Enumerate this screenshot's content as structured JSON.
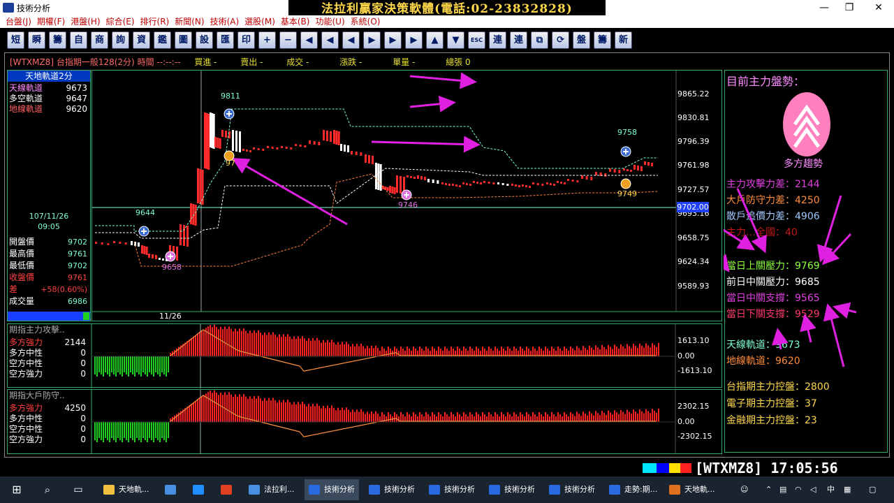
{
  "window": {
    "title": "技術分析",
    "banner": "法拉利贏家決策軟體(電話:02-23832828)"
  },
  "menu": [
    "台盤(J)",
    "期權(F)",
    "港盤(H)",
    "綜合(E)",
    "排行(R)",
    "新聞(N)",
    "技術(A)",
    "選股(M)",
    "基本(B)",
    "功能(U)",
    "系統(O)"
  ],
  "toolbar": [
    "短",
    "瞬",
    "籌",
    "自",
    "商",
    "詢",
    "資",
    "鑑",
    "圖",
    "設",
    "匯",
    "印",
    "+",
    "−",
    "◀",
    "◀",
    "◀",
    "▶",
    "▶",
    "▶",
    "▲",
    "▼",
    "ESC",
    "連",
    "連",
    "⧉",
    "⟳",
    "盤",
    "籌",
    "新"
  ],
  "topinfo": {
    "symbol": "[WTXMZ8]",
    "name": "台指期一般128(2分)",
    "time_label": "時間",
    "time_val": "--:--:--",
    "buy": "買進 -",
    "sell": "賣出 -",
    "deal": "成交 -",
    "change": "漲跌 -",
    "vol": "單量 -",
    "total": "總張 0"
  },
  "left_panel": {
    "header": "天地軌道2分",
    "tracks": [
      {
        "label": "天線軌道",
        "value": "9673",
        "color": "#ff8cff"
      },
      {
        "label": "多空軌道",
        "value": "9647",
        "color": "#ffffff"
      },
      {
        "label": "地線軌道",
        "value": "9620",
        "color": "#ff6060"
      }
    ],
    "date": "107/11/26",
    "time": "09:05",
    "quotes": [
      {
        "label": "開盤價",
        "value": "9702",
        "color": "#ffffff",
        "vcolor": "#7fffd4"
      },
      {
        "label": "最高價",
        "value": "9761",
        "color": "#ffffff",
        "vcolor": "#7fffd4"
      },
      {
        "label": "最低價",
        "value": "9702",
        "color": "#ffffff",
        "vcolor": "#7fffd4"
      },
      {
        "label": "收盤價",
        "value": "9761",
        "color": "#ff4040",
        "vcolor": "#ff4040"
      },
      {
        "label": "差",
        "value": "+58(0.60%)",
        "color": "#ff4040",
        "vcolor": "#ff4040"
      },
      {
        "label": "成交量",
        "value": "6986",
        "color": "#ffffff",
        "vcolor": "#7fffd4"
      }
    ]
  },
  "chart": {
    "y_ticks": [
      "9865.22",
      "9830.81",
      "9796.39",
      "9761.98",
      "9727.57",
      "9693.16",
      "9658.75",
      "9624.34",
      "9589.93"
    ],
    "current_price": "9702.00",
    "x_date": "11/26",
    "markers": [
      {
        "label": "9811",
        "color": "#7fffd4"
      },
      {
        "label": "9644",
        "color": "#7fffd4"
      },
      {
        "label": "9658",
        "color": "#e070e0"
      },
      {
        "label": "9746",
        "color": "#e070e0"
      },
      {
        "label": "9758",
        "color": "#7fffd4"
      },
      {
        "label": "9749",
        "color": "#ffd84a"
      },
      {
        "label": "97",
        "color": "#ffd84a"
      }
    ]
  },
  "sub1": {
    "title": "期指主力攻擊..",
    "rows": [
      {
        "label": "多方強力",
        "value": "2144",
        "color": "#ff4040"
      },
      {
        "label": "多方中性",
        "value": "0",
        "color": "#ffffff"
      },
      {
        "label": "空方中性",
        "value": "0",
        "color": "#ffffff"
      },
      {
        "label": "空方強力",
        "value": "0",
        "color": "#ffffff"
      }
    ],
    "y_ticks": [
      "1613.10",
      "0.00",
      "-1613.10"
    ]
  },
  "sub2": {
    "title": "期指大戶防守..",
    "rows": [
      {
        "label": "多方強力",
        "value": "4250",
        "color": "#ff4040"
      },
      {
        "label": "多方中性",
        "value": "0",
        "color": "#ffffff"
      },
      {
        "label": "空方中性",
        "value": "0",
        "color": "#ffffff"
      },
      {
        "label": "空方強力",
        "value": "0",
        "color": "#ffffff"
      }
    ],
    "y_ticks": [
      "2302.15",
      "0.00",
      "-2302.15"
    ]
  },
  "right_panel": {
    "title": "目前主力盤勢：",
    "trend": "多方趨勢",
    "diffs": [
      {
        "label": "主力攻擊力差：2144",
        "color": "#e040e0"
      },
      {
        "label": "大戶防守力差：4250",
        "color": "#ff8c3a"
      },
      {
        "label": "散戶追價力差：4906",
        "color": "#a0c8ff"
      },
      {
        "label": "主力…全國：40",
        "color": "#c01818"
      }
    ],
    "levels": [
      {
        "label": "當日上關壓力：9769",
        "color": "#8cff40"
      },
      {
        "label": "前日中關壓力：9685",
        "color": "#ffffff"
      },
      {
        "label": "當日中關支撐：9565",
        "color": "#e040e0"
      },
      {
        "label": "當日下關支撐：9529",
        "color": "#ff3a6a"
      }
    ],
    "tracks": [
      {
        "label": "天線軌道：9673",
        "color": "#7fffd4"
      },
      {
        "label": "地線軌道：9620",
        "color": "#ff8c3a"
      }
    ],
    "control": [
      {
        "label": "台指期主力控盤：2800",
        "color": "#ffd84a"
      },
      {
        "label": "電子期主力控盤：37",
        "color": "#ffd84a"
      },
      {
        "label": "金融期主力控盤：23",
        "color": "#ffd84a"
      }
    ]
  },
  "status": {
    "symbol": "[WTXMZ8]",
    "clock": "17:05:56"
  },
  "taskbar": [
    {
      "label": "天地軌...",
      "color": "#f0c040"
    },
    {
      "label": "",
      "color": "#4a90e2"
    },
    {
      "label": "",
      "color": "#1e90ff"
    },
    {
      "label": "",
      "color": "#e04020"
    },
    {
      "label": "法拉利...",
      "color": "#4a90e2"
    },
    {
      "label": "技術分析",
      "color": "#2a6ae0"
    },
    {
      "label": "技術分析",
      "color": "#2a6ae0"
    },
    {
      "label": "技術分析",
      "color": "#2a6ae0"
    },
    {
      "label": "技術分析",
      "color": "#2a6ae0"
    },
    {
      "label": "技術分析",
      "color": "#2a6ae0"
    },
    {
      "label": "走勢:期...",
      "color": "#2a6ae0"
    },
    {
      "label": "天地軌...",
      "color": "#e07020"
    }
  ],
  "tray": {
    "ime": "中"
  }
}
